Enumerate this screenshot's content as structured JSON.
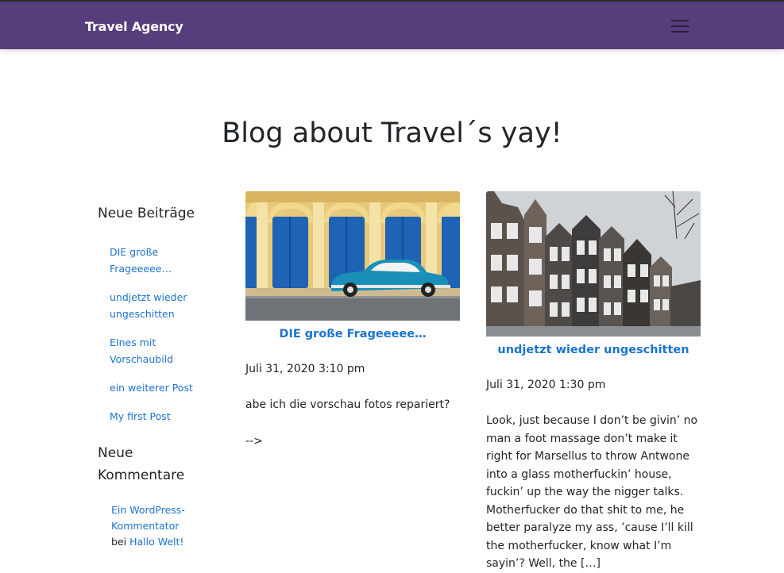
{
  "header": {
    "brand": "Travel Agency",
    "menu_icon": "hamburger-menu-icon"
  },
  "page": {
    "title": "Blog about Travel´s yay!"
  },
  "sidebar": {
    "recent_title": "Neue Beiträge",
    "recent_posts": [
      "DIE große Frageeeee…",
      "undjetzt wieder ungeschitten",
      "EInes mit Vorschaubild",
      "ein weiterer Post",
      "My first Post"
    ],
    "comments_title": "Neue Kommentare",
    "comments": [
      {
        "author": "Ein WordPress-Kommentator",
        "connector": "bei",
        "post": "Hallo Welt!"
      }
    ]
  },
  "posts": [
    {
      "title": "DIE große Frageeeee…",
      "date": "Juli 31, 2020 3:10 pm",
      "excerpt": "abe ich die vorschau fotos repariert?",
      "extra": "-->"
    },
    {
      "title": "undjetzt wieder ungeschitten",
      "date": "Juli 31, 2020 1:30 pm",
      "excerpt": "Look, just because I don’t be givin’ no man a foot massage don’t make it right for Marsellus to throw Antwone into a glass motherfuckin’ house, fuckin’ up the way the nigger talks. Motherfucker do that shit to me, he better paralyze my ass, ’cause I’ll kill the motherfucker, know what I’m sayin’? Well, the […]"
    }
  ],
  "colors": {
    "navbar": "#563d7c",
    "link": "#1b73d1",
    "text": "#212529"
  }
}
